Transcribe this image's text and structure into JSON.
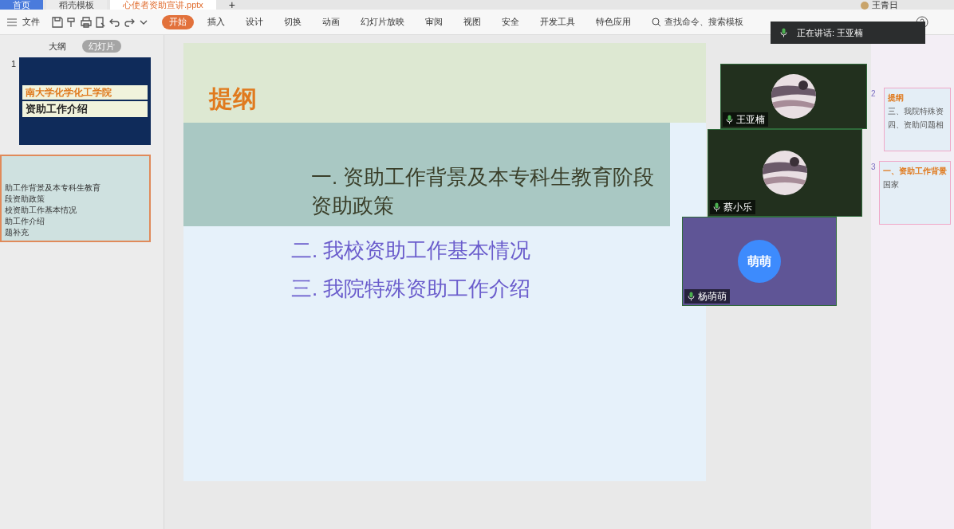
{
  "tabs": [
    {
      "label": "首页",
      "kind": "home",
      "selected": false
    },
    {
      "label": "稻壳模板",
      "kind": "doc",
      "selected": false
    },
    {
      "label": "心使者资助宣讲.pptx",
      "kind": "doc",
      "selected": true
    }
  ],
  "new_tab": "+",
  "user": {
    "name": "王青日"
  },
  "menu": {
    "label": "文件"
  },
  "ribbon_tabs": [
    {
      "label": "开始",
      "selected": true
    },
    {
      "label": "插入",
      "selected": false
    },
    {
      "label": "设计",
      "selected": false
    },
    {
      "label": "切换",
      "selected": false
    },
    {
      "label": "动画",
      "selected": false
    },
    {
      "label": "幻灯片放映",
      "selected": false
    },
    {
      "label": "审阅",
      "selected": false
    },
    {
      "label": "视图",
      "selected": false
    },
    {
      "label": "安全",
      "selected": false
    },
    {
      "label": "开发工具",
      "selected": false
    },
    {
      "label": "特色应用",
      "selected": false
    }
  ],
  "search": {
    "placeholder": "查找命令、搜索模板"
  },
  "panel_tabs": [
    {
      "label": "大纲",
      "selected": false
    },
    {
      "label": "幻灯片",
      "selected": true
    }
  ],
  "thumbnails": [
    {
      "number": "1",
      "lines": [
        "南大学化学化工学院",
        "资助工作介绍"
      ]
    },
    {
      "lines": [
        "助工作背景及本专科生教育",
        "段资助政策",
        "校资助工作基本情况",
        "助工作介绍",
        "题补充"
      ]
    }
  ],
  "slide": {
    "title": "提纲",
    "items": [
      {
        "text": "一. 资助工作背景及本专科生教育阶段资助政策",
        "color": "#3a3f2a"
      },
      {
        "text": "二. 我校资助工作基本情况",
        "color": "#6a5ccc"
      },
      {
        "text": "三. 我院特殊资助工作介绍",
        "color": "#6a5ccc"
      }
    ]
  },
  "right_thumbnails": [
    {
      "number": "2",
      "title": "提纲",
      "lines": [
        "三、我院特殊资",
        "四、资助问题相"
      ]
    },
    {
      "number": "3",
      "title": "一、资助工作背景",
      "lines": [
        "国家"
      ]
    }
  ],
  "call": {
    "speaking": "正在讲话: 王亚楠",
    "participants": [
      {
        "name": "王亚楠",
        "color": "#22301e"
      },
      {
        "name": "蔡小乐",
        "color": "#22301e"
      },
      {
        "name": "杨萌萌",
        "kind": "initials",
        "initials": "萌萌",
        "color": "#5f5596"
      }
    ]
  }
}
